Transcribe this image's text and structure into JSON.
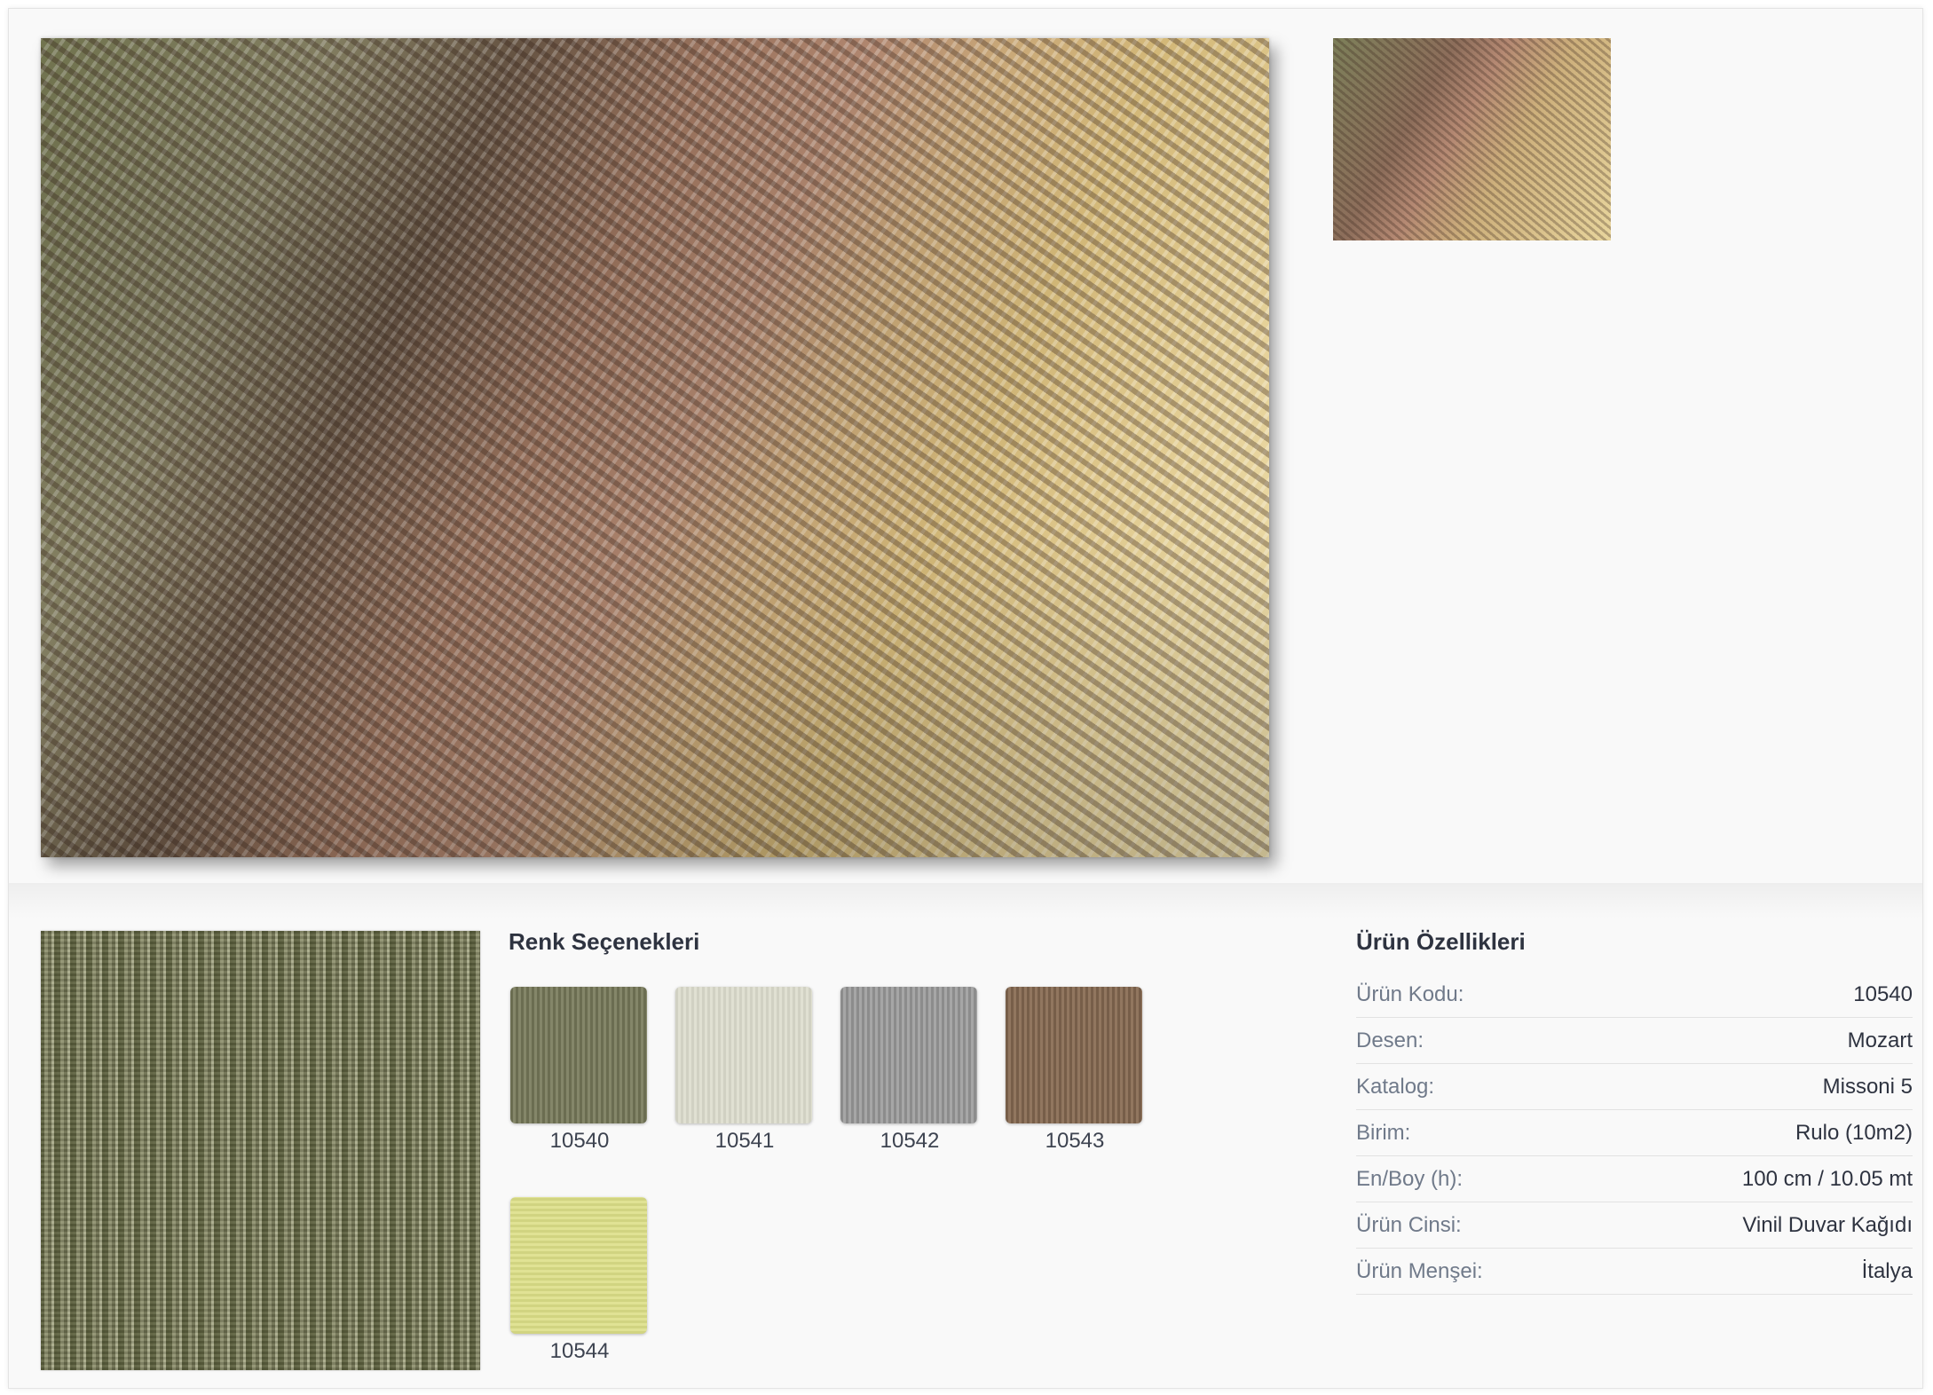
{
  "gallery": {
    "main_image_alt": "fabric-pattern-image",
    "thumbnail_alt": "fabric-pattern-thumbnail"
  },
  "colors_section": {
    "title": "Renk Seçenekleri",
    "options": [
      {
        "code": "10540",
        "color": "#7a7c5c"
      },
      {
        "code": "10541",
        "color": "#dcdccd"
      },
      {
        "code": "10542",
        "color": "#9c9c9c"
      },
      {
        "code": "10543",
        "color": "#8a6e55"
      },
      {
        "code": "10544",
        "color": "#dcdf88"
      }
    ]
  },
  "properties_section": {
    "title": "Ürün Özellikleri",
    "rows": [
      {
        "label": "Ürün Kodu:",
        "value": "10540"
      },
      {
        "label": "Desen:",
        "value": "Mozart"
      },
      {
        "label": "Katalog:",
        "value": "Missoni 5"
      },
      {
        "label": "Birim:",
        "value": "Rulo (10m2)"
      },
      {
        "label": "En/Boy (h):",
        "value": "100 cm / 10.05 mt"
      },
      {
        "label": "Ürün Cinsi:",
        "value": "Vinil Duvar Kağıdı"
      },
      {
        "label": "Ürün Menşei:",
        "value": "İtalya"
      }
    ]
  }
}
